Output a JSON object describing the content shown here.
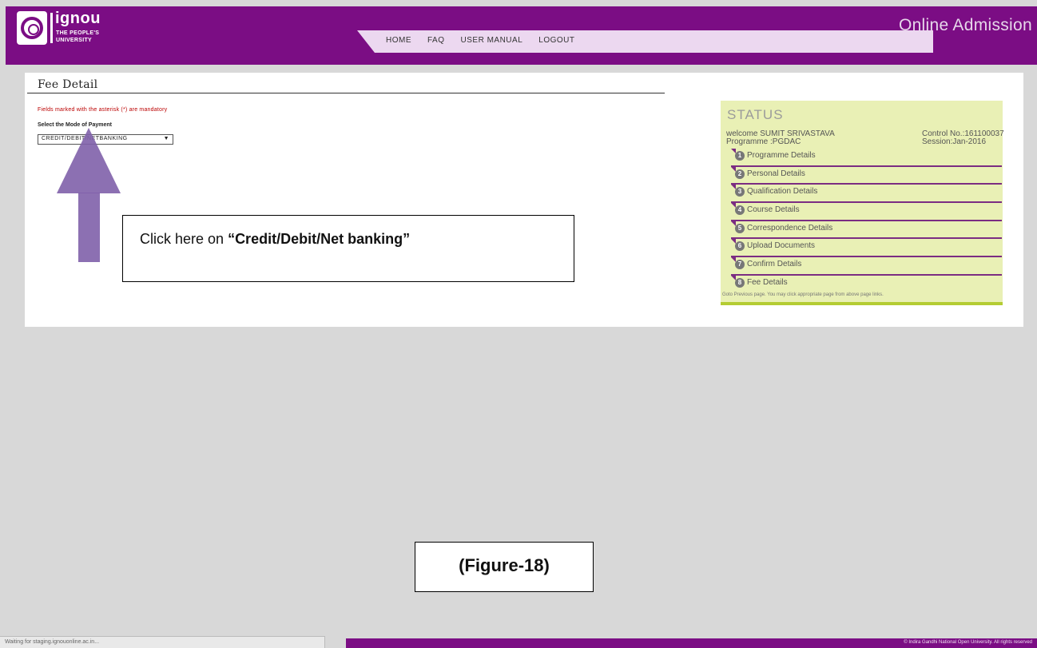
{
  "header": {
    "logo_text": "ignou",
    "logo_sub1": "THE PEOPLE'S",
    "logo_sub2": "UNIVERSITY",
    "title": "Online Admission",
    "nav": [
      "HOME",
      "FAQ",
      "USER MANUAL",
      "LOGOUT"
    ],
    "brand_color": "#7b0d84"
  },
  "main": {
    "section_title": "Fee Detail",
    "mandatory_note": "Fields marked with the asterisk (*) are mandatory",
    "mode_label": "Select the Mode of Payment",
    "mode_value": "CREDIT/DEBIT/NETBANKING",
    "caret_icon": "▼"
  },
  "callout": {
    "text": "Click here on ",
    "strong": "“Credit/Debit/Net banking”"
  },
  "status": {
    "title": "STATUS",
    "welcome": "welcome SUMIT SRIVASTAVA",
    "programme": "Programme :PGDAC",
    "control_no": "Control No.:161100037",
    "session": "Session:Jan-2016",
    "steps": [
      {
        "num": "1",
        "label": "Programme Details"
      },
      {
        "num": "2",
        "label": "Personal Details"
      },
      {
        "num": "3",
        "label": "Qualification Details"
      },
      {
        "num": "4",
        "label": "Course Details"
      },
      {
        "num": "5",
        "label": "Correspondence Details"
      },
      {
        "num": "6",
        "label": "Upload Documents"
      },
      {
        "num": "7",
        "label": "Confirm Details"
      },
      {
        "num": "8",
        "label": "Fee Details"
      }
    ],
    "note": "Goto Previous page. You may click appropriate page from above page links.",
    "panel_color": "#e9f0b5"
  },
  "figure_label": "(Figure-18)",
  "footer": {
    "copyright": "© Indira Gandhi National Open University. All rights reserved"
  },
  "browser_status": "Waiting for staging.ignouonline.ac.in..."
}
